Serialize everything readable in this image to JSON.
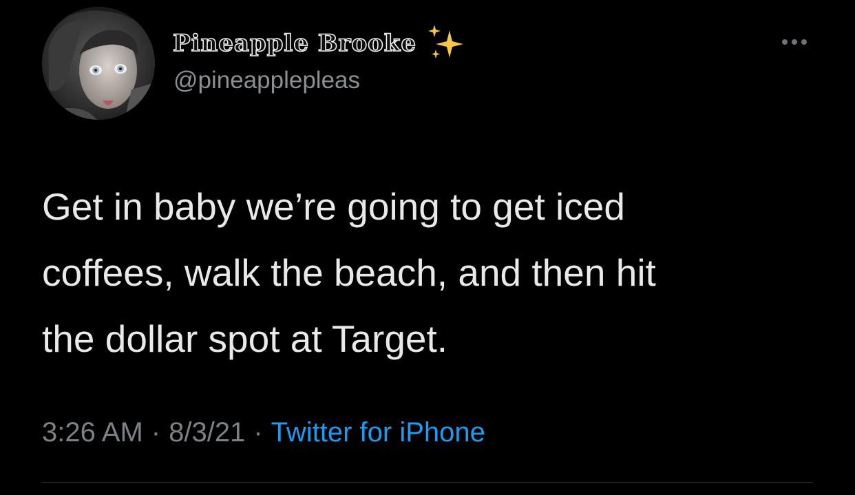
{
  "tweet": {
    "author": {
      "display_name": "𝕻𝖎𝖓𝖊𝖆𝖕𝖕𝖑𝖊 𝕭𝖗𝖔𝖔𝖐𝖊",
      "display_name_plain": "Pineapple Brooke",
      "handle": "@pineapplepleas",
      "name_emoji": "sparkles-icon",
      "avatar": "profile-photo"
    },
    "text": "Get in baby we’re going to get iced\ncoffees, walk the beach, and then hit\nthe dollar spot at Target.",
    "time": "3:26 AM",
    "separator": "·",
    "date": "8/3/21",
    "source": "Twitter for iPhone",
    "more_menu": "more-icon"
  },
  "colors": {
    "background": "#000000",
    "text": "#e7e9ea",
    "secondary_text": "#7c8186",
    "link": "#1d9bf0",
    "sparkles": "#f5c64a"
  }
}
